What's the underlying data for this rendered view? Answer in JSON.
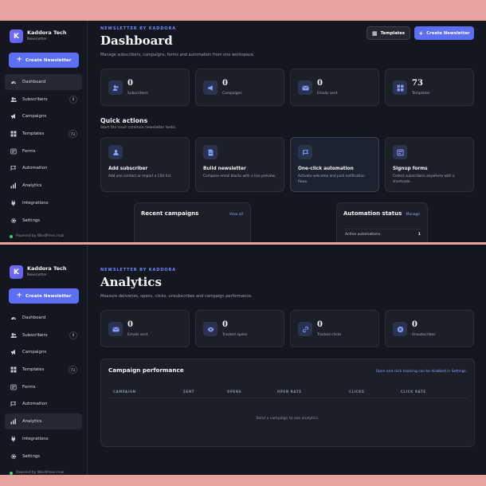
{
  "brand": {
    "name": "Kaddora Tech",
    "sub": "Newsletter",
    "logo_letter": "K"
  },
  "sidebar": {
    "create_label": "Create Newsletter",
    "items": [
      {
        "label": "Dashboard",
        "icon": "gauge-icon"
      },
      {
        "label": "Subscribers",
        "icon": "users-icon",
        "badge": "0"
      },
      {
        "label": "Campaigns",
        "icon": "megaphone-icon"
      },
      {
        "label": "Templates",
        "icon": "grid-icon",
        "badge": "73"
      },
      {
        "label": "Forms",
        "icon": "form-icon"
      },
      {
        "label": "Automation",
        "icon": "flag-icon"
      },
      {
        "label": "Analytics",
        "icon": "bar-chart-icon"
      },
      {
        "label": "Integrations",
        "icon": "plug-icon"
      },
      {
        "label": "Settings",
        "icon": "gear-icon"
      }
    ],
    "powered": "Powered by WordPress mail"
  },
  "dashboard": {
    "eyebrow": "NEWSLETTER BY KADDORA",
    "title": "Dashboard",
    "description": "Manage subscribers, campaigns, forms and automation from one workspace.",
    "templates_btn": "Templates",
    "create_btn": "Create Newsletter",
    "stats": [
      {
        "value": "0",
        "label": "Subscribers",
        "icon": "users-icon"
      },
      {
        "value": "0",
        "label": "Campaigns",
        "icon": "megaphone-icon"
      },
      {
        "value": "0",
        "label": "Emails sent",
        "icon": "mail-icon"
      },
      {
        "value": "73",
        "label": "Templates",
        "icon": "grid-icon"
      }
    ],
    "quick_title": "Quick actions",
    "quick_sub": "Start the most common newsletter tasks.",
    "quick": [
      {
        "title": "Add subscriber",
        "desc": "Add one contact or import a CSV list.",
        "icon": "user-add-icon"
      },
      {
        "title": "Build newsletter",
        "desc": "Compose email blocks with a live preview.",
        "icon": "document-icon"
      },
      {
        "title": "One-click automation",
        "desc": "Activate welcome and post notification flows.",
        "icon": "flag-icon"
      },
      {
        "title": "Signup forms",
        "desc": "Collect subscribers anywhere with a shortcode.",
        "icon": "form-icon"
      }
    ],
    "recent_title": "Recent campaigns",
    "recent_link": "View all",
    "automation_title": "Automation status",
    "automation_link": "Manage",
    "automation_row_label": "Active automations",
    "automation_row_value": "1"
  },
  "analytics": {
    "eyebrow": "NEWSLETTER BY KADDORA",
    "title": "Analytics",
    "description": "Measure deliveries, opens, clicks, unsubscribes and campaign performance.",
    "stats": [
      {
        "value": "0",
        "label": "Emails sent",
        "icon": "mail-icon"
      },
      {
        "value": "0",
        "label": "Tracked opens",
        "icon": "eye-icon"
      },
      {
        "value": "0",
        "label": "Tracked clicks",
        "icon": "link-icon"
      },
      {
        "value": "0",
        "label": "Unsubscribes",
        "icon": "close-circle-icon"
      }
    ],
    "perf_title": "Campaign performance",
    "perf_note": "Open and click tracking can be disabled in Settings.",
    "columns": [
      "CAMPAIGN",
      "SENT",
      "OPENS",
      "OPEN RATE",
      "CLICKS",
      "CLICK RATE"
    ],
    "empty": "Send a campaign to see analytics."
  },
  "colors": {
    "accent": "#5b6ef5",
    "background": "#14171f",
    "card": "#1b1f28",
    "frame": "#e8a3a1"
  }
}
